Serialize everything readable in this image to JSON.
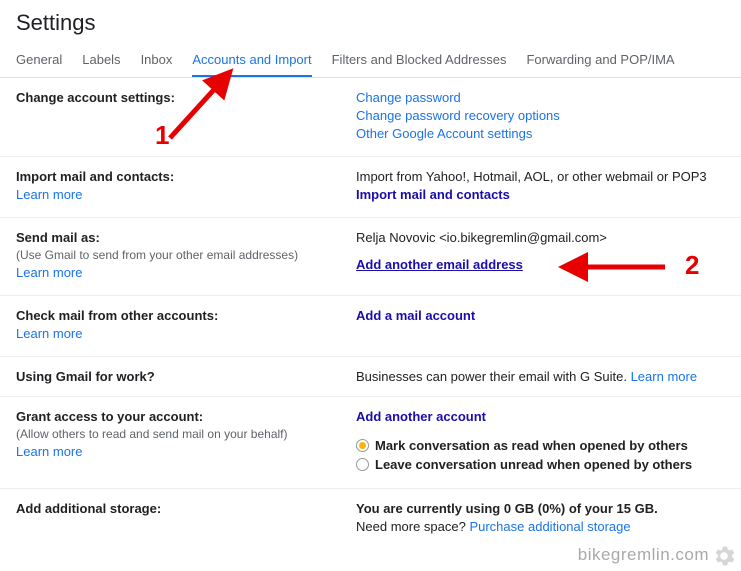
{
  "title": "Settings",
  "tabs": {
    "general": "General",
    "labels": "Labels",
    "inbox": "Inbox",
    "accounts": "Accounts and Import",
    "filters": "Filters and Blocked Addresses",
    "forwarding": "Forwarding and POP/IMA"
  },
  "annotations": {
    "one": "1",
    "two": "2"
  },
  "watermark": "bikegremlin.com",
  "section1": {
    "label": "Change account settings:",
    "link1": "Change password",
    "link2": "Change password recovery options",
    "link3": "Other Google Account settings"
  },
  "section2": {
    "label": "Import mail and contacts:",
    "learn": "Learn more",
    "desc": "Import from Yahoo!, Hotmail, AOL, or other webmail or POP3",
    "action": "Import mail and contacts"
  },
  "section3": {
    "label": "Send mail as:",
    "sub": "(Use Gmail to send from your other email addresses)",
    "learn": "Learn more",
    "identity": "Relja Novovic <io.bikegremlin@gmail.com>",
    "action": "Add another email address"
  },
  "section4": {
    "label": "Check mail from other accounts:",
    "learn": "Learn more",
    "action": "Add a mail account"
  },
  "section5": {
    "label": "Using Gmail for work?",
    "desc": "Businesses can power their email with G Suite. ",
    "learn": "Learn more"
  },
  "section6": {
    "label": "Grant access to your account:",
    "sub": "(Allow others to read and send mail on your behalf)",
    "learn": "Learn more",
    "action": "Add another account",
    "radio1": "Mark conversation as read when opened by others",
    "radio2": "Leave conversation unread when opened by others"
  },
  "section7": {
    "label": "Add additional storage:",
    "desc1": "You are currently using 0 GB (0%) of your 15 GB.",
    "desc2": "Need more space? ",
    "link": "Purchase additional storage"
  }
}
